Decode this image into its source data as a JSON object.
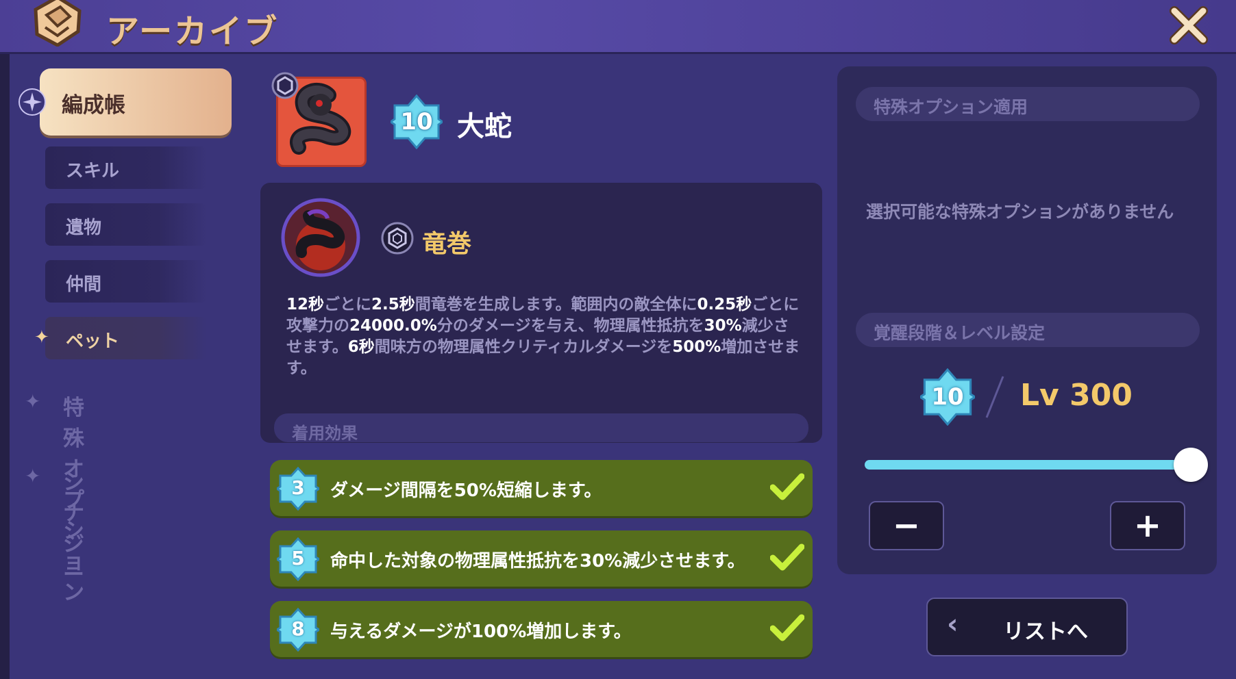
{
  "header": {
    "title": "アーカイブ",
    "logo_icon": "fist-emblem-icon",
    "close_icon": "close-icon"
  },
  "sidebar": {
    "active_section": "編成帳",
    "sub_items": [
      {
        "label": "スキル"
      },
      {
        "label": "遺物"
      },
      {
        "label": "仲間"
      },
      {
        "label": "ペット",
        "active": true
      }
    ],
    "categories": [
      {
        "label": "特殊オプション"
      },
      {
        "label": "シナジー"
      }
    ]
  },
  "pet": {
    "name": "大蛇",
    "awakening": "10"
  },
  "skill": {
    "name": "竜巻",
    "desc": [
      {
        "t": "12秒",
        "b": true
      },
      {
        "t": "ごとに",
        "b": false
      },
      {
        "t": "2.5秒",
        "b": true
      },
      {
        "t": "間竜巻を生成します。範囲内の敵全体に",
        "b": false
      },
      {
        "t": "0.25秒",
        "b": true
      },
      {
        "t": "ごとに攻撃力の",
        "b": false
      },
      {
        "t": "24000.0%",
        "b": true
      },
      {
        "t": "分のダメージを与え、物理属性抵抗を",
        "b": false
      },
      {
        "t": "30%",
        "b": true
      },
      {
        "t": "減少させます。",
        "b": false
      },
      {
        "t": "6秒",
        "b": true
      },
      {
        "t": "間味方の物理属性クリティカルダメージを",
        "b": false
      },
      {
        "t": "500%",
        "b": true
      },
      {
        "t": "増加させます。",
        "b": false
      }
    ],
    "equip_label": "着用効果"
  },
  "effects": [
    {
      "level": "3",
      "text": "ダメージ間隔を50%短縮します。",
      "checked": true
    },
    {
      "level": "5",
      "text": "命中した対象の物理属性抵抗を30%減少させます。",
      "checked": true
    },
    {
      "level": "8",
      "text": "与えるダメージが100%増加します。",
      "checked": true
    }
  ],
  "right_panel": {
    "special_header": "特殊オプション適用",
    "no_option_text": "選択可能な特殊オプションがありません",
    "level_header": "覚醒段階＆レベル設定",
    "awakening": "10",
    "level_text": "Lv 300",
    "slider_fraction": 1.0,
    "minus_label": "−",
    "plus_label": "+",
    "list_button_label": "リストへ",
    "list_button_icon": "chevron-left-icon"
  },
  "colors": {
    "gold": "#f3c96a",
    "effect_green": "#566e1c",
    "check_green": "#c8f03c",
    "gem_blue": "#6fd9f0"
  }
}
